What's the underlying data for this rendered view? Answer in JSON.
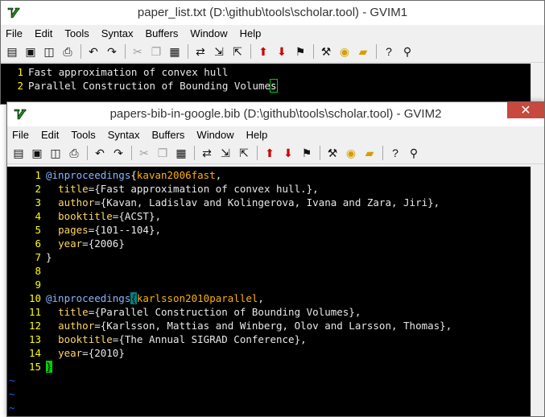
{
  "menu": [
    "File",
    "Edit",
    "Tools",
    "Syntax",
    "Buffers",
    "Window",
    "Help"
  ],
  "toolbar_icons": [
    "open-icon",
    "save-icon",
    "save-all-icon",
    "print-icon",
    "undo-icon",
    "redo-icon",
    "cut-icon",
    "copy-icon",
    "paste-icon",
    "find-replace-icon",
    "find-next-icon",
    "find-prev-icon",
    "load-session-icon",
    "save-session-icon",
    "run-script-icon",
    "make-icon",
    "build-tags-icon",
    "jump-tag-icon",
    "help-icon",
    "find-help-icon"
  ],
  "win1": {
    "title": "paper_list.txt (D:\\github\\tools\\scholar.tool) - GVIM1",
    "lines": [
      {
        "num": "1",
        "text": "Fast approximation of convex hull"
      },
      {
        "num": "2",
        "text": "Parallel Construction of Bounding Volumes"
      }
    ]
  },
  "win2": {
    "title": "papers-bib-in-google.bib (D:\\github\\tools\\scholar.tool) - GVIM2",
    "close_glyph": "✕",
    "lines": {
      "l1": {
        "num": "1",
        "type": "@inproceedings",
        "brace": "{",
        "key": "kavan2006fast",
        "rest": ","
      },
      "l2": {
        "num": "2",
        "field": "title",
        "value": "={Fast approximation of convex hull.},"
      },
      "l3": {
        "num": "3",
        "field": "author",
        "value": "={Kavan, Ladislav and Kolingerova, Ivana and Zara, Jiri},"
      },
      "l4": {
        "num": "4",
        "field": "booktitle",
        "value": "={ACST},"
      },
      "l5": {
        "num": "5",
        "field": "pages",
        "value": "={101--104},"
      },
      "l6": {
        "num": "6",
        "field": "year",
        "value": "={2006}"
      },
      "l7": {
        "num": "7",
        "text": "}"
      },
      "l8": {
        "num": "8"
      },
      "l9": {
        "num": "9"
      },
      "l10": {
        "num": "10",
        "type": "@inproceedings",
        "brace": "{",
        "key": "karlsson2010parallel",
        "rest": ","
      },
      "l11": {
        "num": "11",
        "field": "title",
        "value": "={Parallel Construction of Bounding Volumes},"
      },
      "l12": {
        "num": "12",
        "field": "author",
        "value": "={Karlsson, Mattias and Winberg, Olov and Larsson, Thomas},"
      },
      "l13": {
        "num": "13",
        "field": "booktitle",
        "value": "={The Annual SIGRAD Conference},"
      },
      "l14": {
        "num": "14",
        "field": "year",
        "value": "={2010}"
      },
      "l15": {
        "num": "15",
        "text": "}"
      }
    },
    "tilde": "~"
  }
}
